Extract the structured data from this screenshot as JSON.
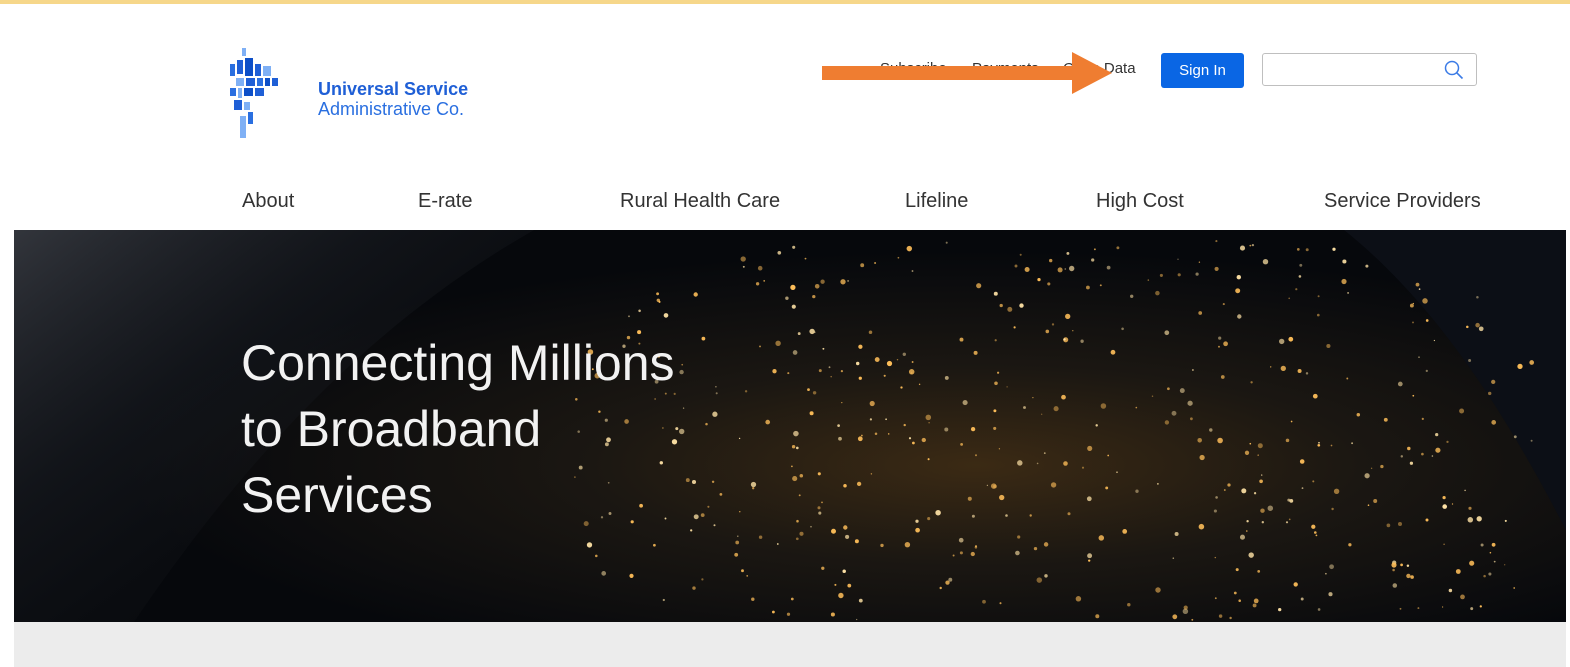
{
  "header": {
    "logo": {
      "line1": "Universal Service",
      "line2": "Administrative Co."
    },
    "utility_nav": [
      {
        "label": "Subscribe"
      },
      {
        "label": "Payments"
      },
      {
        "label": "Open Data"
      }
    ],
    "sign_in_label": "Sign In",
    "search": {
      "placeholder": "",
      "value": ""
    }
  },
  "main_nav": [
    {
      "label": "About"
    },
    {
      "label": "E-rate"
    },
    {
      "label": "Rural Health Care"
    },
    {
      "label": "Lifeline"
    },
    {
      "label": "High Cost"
    },
    {
      "label": "Service Providers"
    }
  ],
  "hero": {
    "line1": "Connecting Millions",
    "line2": "to Broadband",
    "line3": "Services"
  },
  "colors": {
    "brand_blue": "#0a66e4",
    "annotation_arrow": "#ef7d31",
    "top_border": "#f6d78a"
  },
  "icons": [
    "logo-mark-icon",
    "search-icon",
    "annotation-arrow-icon"
  ]
}
